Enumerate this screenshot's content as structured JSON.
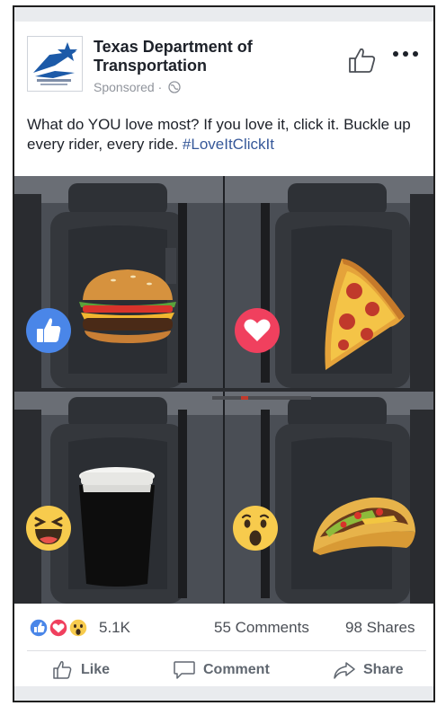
{
  "post": {
    "page_name": "Texas Department of Transportation",
    "sponsored_label": "Sponsored · ",
    "caption_text": "What do YOU love most? If you love it, click it. Buckle up every rider, every ride. ",
    "hashtag": "#LoveItClickIt"
  },
  "image": {
    "quadrants": [
      {
        "reaction": "like",
        "food": "hamburger"
      },
      {
        "reaction": "love",
        "food": "pizza-slice"
      },
      {
        "reaction": "haha",
        "food": "coffee-cup"
      },
      {
        "reaction": "wow",
        "food": "taco"
      }
    ]
  },
  "stats": {
    "reactions_count": "5.1K",
    "comments": "55 Comments",
    "shares": "98 Shares"
  },
  "actions": {
    "like": "Like",
    "comment": "Comment",
    "share": "Share"
  },
  "colors": {
    "facebook_blue": "#4267b2",
    "love_red": "#f0405e",
    "yellow_emoji": "#f7cb4d",
    "link_blue": "#365899",
    "secondary_text": "#90949c"
  }
}
